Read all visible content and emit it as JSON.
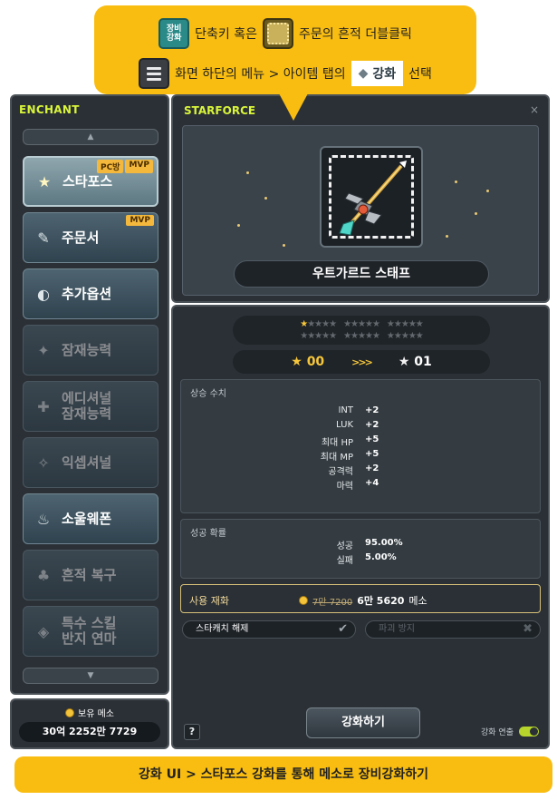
{
  "tooltip": {
    "equip_icon_text": "장비\n강화",
    "row1_text_a": "단축키 혹은",
    "row1_text_b": "주문의 흔적 더블클릭",
    "row2_text_a": "화면 하단의 메뉴 > 아이템 탭의",
    "row2_tag": "강화",
    "row2_text_b": "선택"
  },
  "sidebar": {
    "title": "ENCHANT",
    "items": [
      {
        "label": "스타포스",
        "icon": "star-icon",
        "badges": [
          "PC방",
          "MVP"
        ],
        "state": "active"
      },
      {
        "label": "주문서",
        "icon": "scroll-icon",
        "badges": [
          "MVP"
        ],
        "state": "normal"
      },
      {
        "label": "추가옵션",
        "icon": "gem-icon",
        "badges": [],
        "state": "normal"
      },
      {
        "label": "잠재능력",
        "icon": "potential-icon",
        "badges": [],
        "state": "dim"
      },
      {
        "label": "에디셔널\n잠재능력",
        "icon": "additional-potential-icon",
        "badges": [],
        "state": "dim"
      },
      {
        "label": "익셉셔널",
        "icon": "exceptional-icon",
        "badges": [],
        "state": "dim"
      },
      {
        "label": "소울웨폰",
        "icon": "soul-icon",
        "badges": [],
        "state": "normal"
      },
      {
        "label": "흔적 복구",
        "icon": "restore-icon",
        "badges": [],
        "state": "dim"
      },
      {
        "label": "특수 스킬\n반지 연마",
        "icon": "ring-icon",
        "badges": [],
        "state": "dim"
      }
    ]
  },
  "mesos": {
    "label": "보유 메소",
    "value": "30억 2252만 7729"
  },
  "starforce": {
    "title": "STARFORCE",
    "close": "×",
    "item_name": "우트가르드 스태프",
    "stars_row1": [
      "★★★★★",
      "★★★★★",
      "★★★★★"
    ],
    "stars_row2": [
      "★★★★★",
      "★★★★★",
      "★★★★★"
    ],
    "lit_stars": 1,
    "from_star": "00",
    "to_star": "01",
    "arrows": ">>>",
    "increase_title": "상승 수치",
    "stats": [
      {
        "k": "INT",
        "v": "+2"
      },
      {
        "k": "LUK",
        "v": "+2"
      },
      {
        "k": "최대 HP",
        "v": "+5"
      },
      {
        "k": "최대 MP",
        "v": "+5"
      },
      {
        "k": "공격력",
        "v": "+2"
      },
      {
        "k": "마력",
        "v": "+4"
      }
    ],
    "prob_title": "성공 확률",
    "probs": [
      {
        "k": "성공",
        "v": "95.00%"
      },
      {
        "k": "실패",
        "v": "5.00%"
      }
    ],
    "cost_label": "사용 재화",
    "cost_old": "7만 7200",
    "cost_new": "6만 5620",
    "cost_unit": "메소",
    "option_starcatch": "스타캐치 해제",
    "option_protect": "파괴 방지",
    "help": "?",
    "enhance_button": "강화하기",
    "auto_label": "강화 연출"
  },
  "bottom_caption": "강화 UI > 스타포스 강화를 통해 메소로 장비강화하기",
  "colors": {
    "accent_yellow": "#f9bd11",
    "title_green": "#d9f53a",
    "star_gold": "#f7c73a"
  }
}
